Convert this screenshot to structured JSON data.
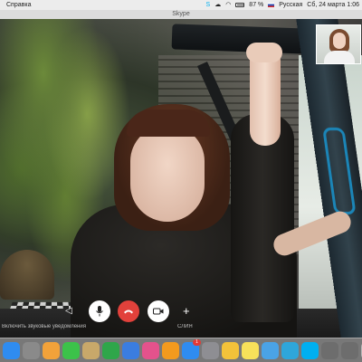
{
  "menubar": {
    "app_menu": "Справка",
    "battery_percent": "87 %",
    "input_language": "Русская",
    "datetime": "Сб, 24 марта  1:06"
  },
  "window": {
    "title": "Skype"
  },
  "call_controls": {
    "back_glyph": "◁",
    "plus_glyph": "+"
  },
  "notification": {
    "left_text": "Включить звуковые уведомления",
    "right_text": "СЛИЯ"
  },
  "dock": {
    "items": [
      {
        "name": "finder",
        "color": "#2f8cf0"
      },
      {
        "name": "launchpad",
        "color": "#8a8a8a"
      },
      {
        "name": "photos",
        "color": "#f2a23a"
      },
      {
        "name": "facetime",
        "color": "#3cc24a"
      },
      {
        "name": "preview",
        "color": "#c8a86a"
      },
      {
        "name": "numbers",
        "color": "#2fa64a"
      },
      {
        "name": "keynote",
        "color": "#3b7de0"
      },
      {
        "name": "itunes",
        "color": "#e4528c"
      },
      {
        "name": "ibooks",
        "color": "#f39a1e"
      },
      {
        "name": "app-store",
        "color": "#2f8cf0",
        "badge": "1"
      },
      {
        "name": "system-preferences",
        "color": "#8e8e93"
      },
      {
        "name": "pencil",
        "color": "#f3c23a"
      },
      {
        "name": "stickies",
        "color": "#f7e15a"
      },
      {
        "name": "cloud",
        "color": "#4aa3e6"
      },
      {
        "name": "telegram",
        "color": "#2ea6da"
      },
      {
        "name": "skype",
        "color": "#00aff0"
      },
      {
        "name": "photo-viewer",
        "color": "#6d6d6d"
      },
      {
        "name": "screenshot",
        "color": "#6d6d6d"
      },
      {
        "name": "trash",
        "color": "#b7b7b7"
      }
    ]
  }
}
